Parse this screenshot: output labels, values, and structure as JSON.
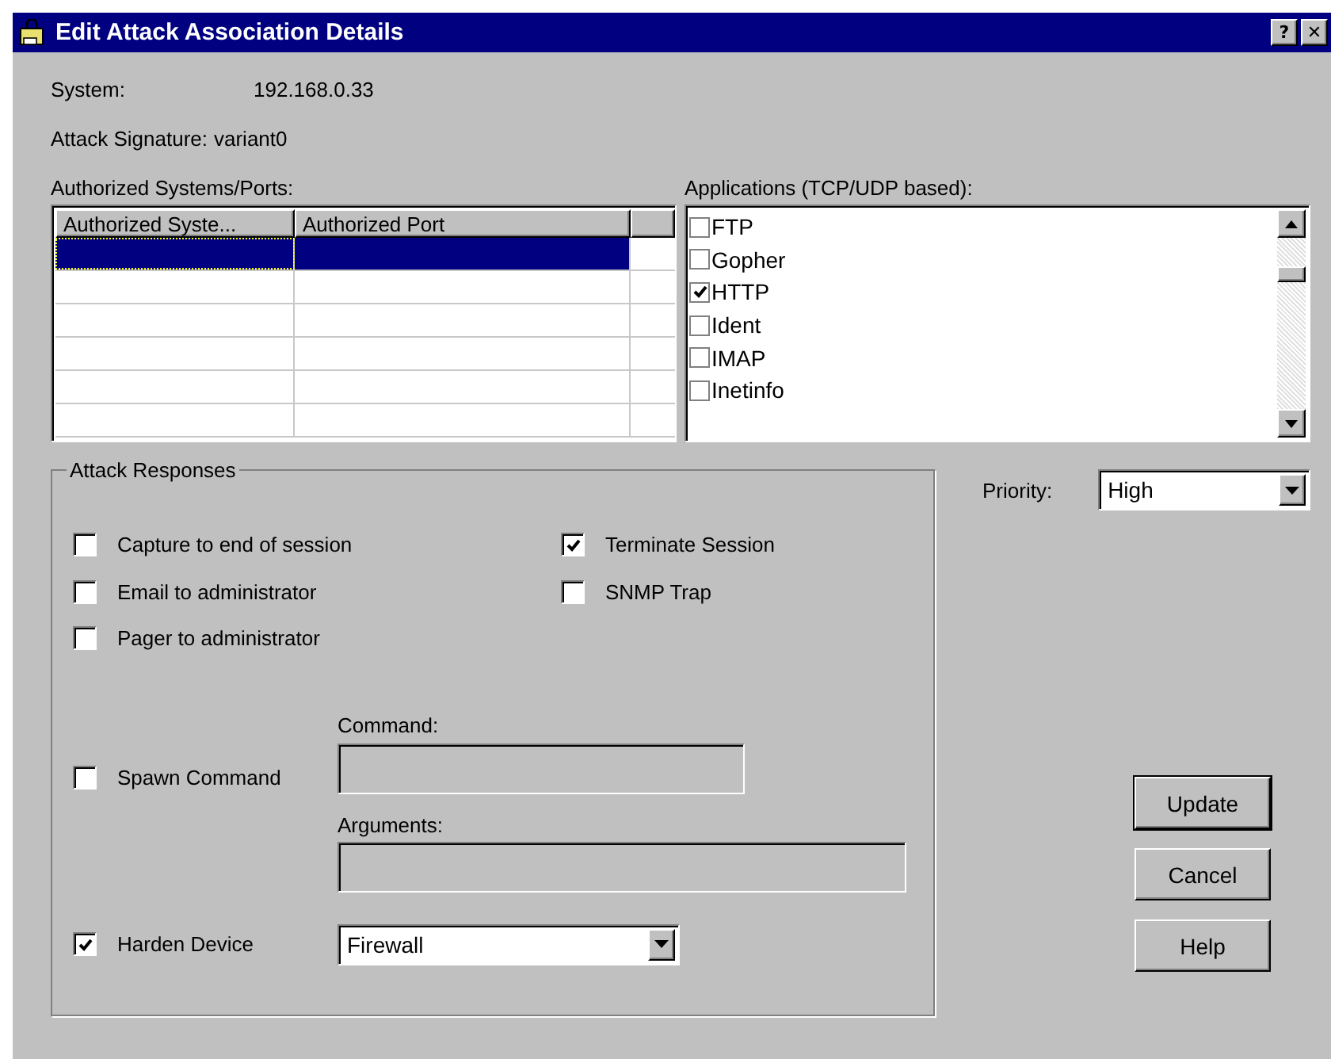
{
  "window": {
    "title": "Edit Attack Association Details",
    "buttons": [
      "?",
      "✕"
    ]
  },
  "system": {
    "label": "System:",
    "value": "192.168.0.33"
  },
  "signature": {
    "label": "Attack Signature:",
    "value": "variant0"
  },
  "authorized": {
    "label": "Authorized Systems/Ports:",
    "columns": [
      "Authorized Syste...",
      "Authorized Port"
    ],
    "rows": [
      {
        "selected": true
      },
      {
        "selected": false
      },
      {
        "selected": false
      },
      {
        "selected": false
      },
      {
        "selected": false
      },
      {
        "selected": false
      }
    ]
  },
  "applications": {
    "label": "Applications (TCP/UDP based):",
    "items": [
      {
        "label": "FTP",
        "checked": false
      },
      {
        "label": "Gopher",
        "checked": false
      },
      {
        "label": "HTTP",
        "checked": true
      },
      {
        "label": "Ident",
        "checked": false
      },
      {
        "label": "IMAP",
        "checked": false
      },
      {
        "label": "Inetinfo",
        "checked": false
      }
    ]
  },
  "responses": {
    "title": "Attack Responses",
    "left": [
      {
        "label": "Capture to end of session",
        "checked": false
      },
      {
        "label": "Email to administrator",
        "checked": false
      },
      {
        "label": "Pager to administrator",
        "checked": false
      }
    ],
    "right": [
      {
        "label": "Terminate Session",
        "checked": true
      },
      {
        "label": "SNMP Trap",
        "checked": false
      }
    ],
    "spawn": {
      "label": "Spawn Command",
      "checked": false,
      "command_label": "Command:",
      "arguments_label": "Arguments:"
    },
    "harden": {
      "label": "Harden Device",
      "checked": true,
      "value": "Firewall"
    }
  },
  "priority": {
    "label": "Priority:",
    "value": "High"
  },
  "buttons": [
    {
      "label": "Update",
      "default": true
    },
    {
      "label": "Cancel",
      "default": false
    },
    {
      "label": "Help",
      "default": false
    }
  ]
}
